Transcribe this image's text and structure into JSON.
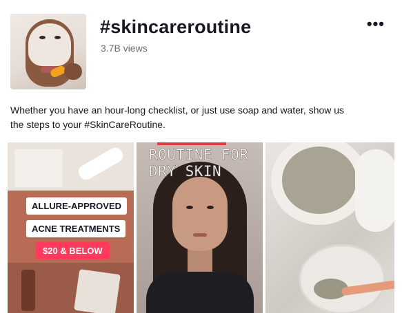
{
  "header": {
    "title": "#skincareroutine",
    "views": "3.7B views",
    "more_label": "•••"
  },
  "description": "Whether you have an hour-long checklist, or just use soap and water, show us the steps to your #SkinCareRoutine.",
  "tiles": [
    {
      "labels": [
        "ALLURE-APPROVED",
        "ACNE TREATMENTS"
      ],
      "price": "$20 & BELOW"
    },
    {
      "overlay": [
        "ROUTINE FOR",
        "DRY SKIN"
      ]
    },
    {}
  ],
  "colors": {
    "price_badge": "#ff3a5c",
    "title_text": "#161823",
    "secondary_text": "#6b6d74"
  },
  "icons": {
    "more": "more-horizontal-icon"
  }
}
